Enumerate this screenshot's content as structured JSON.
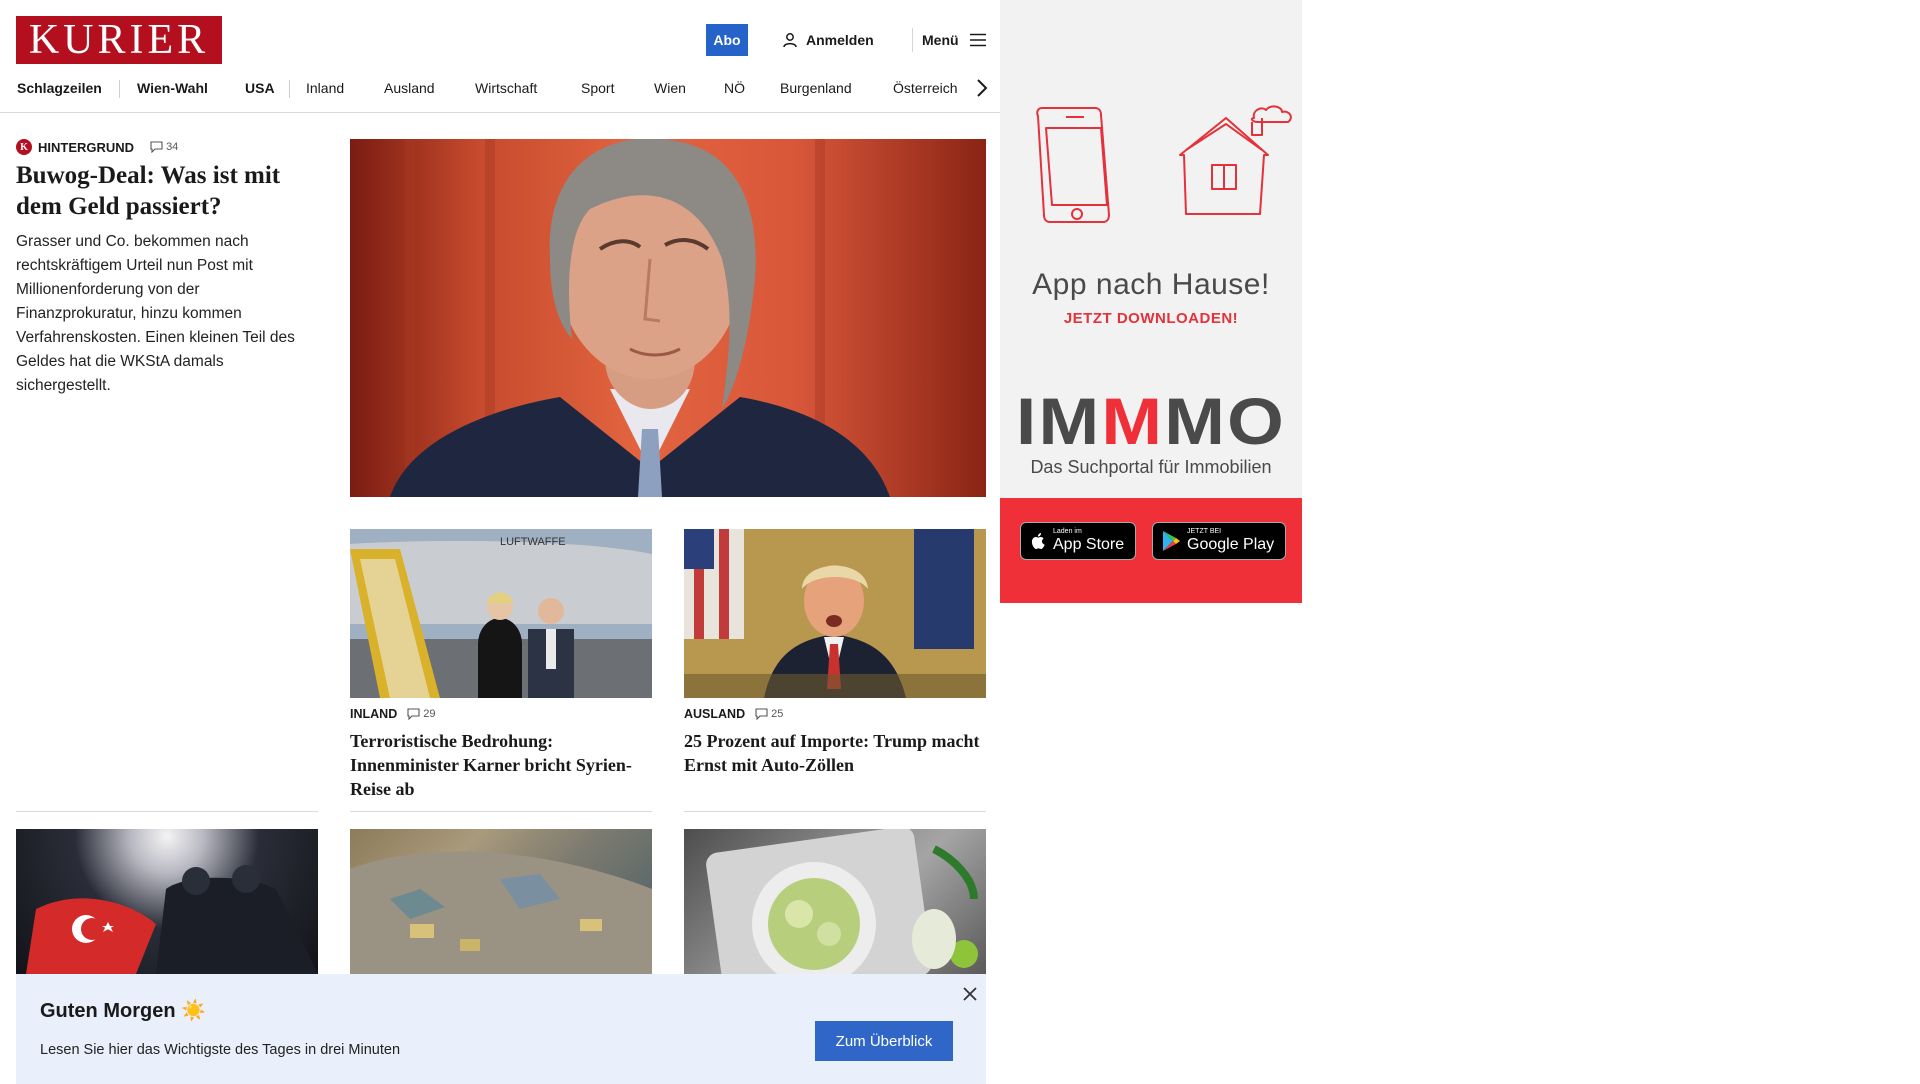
{
  "header": {
    "logo": "KURIER",
    "abo_label": "Abo",
    "login_label": "Anmelden",
    "menu_label": "Menü"
  },
  "nav": {
    "items": [
      "Schlagzeilen",
      "Wien-Wahl",
      "USA",
      "Inland",
      "Ausland",
      "Wirtschaft",
      "Sport",
      "Wien",
      "NÖ",
      "Burgenland",
      "Österreich"
    ]
  },
  "lead": {
    "badge": "K",
    "kicker": "Hintergrund",
    "comments": "34",
    "title": "Buwog-Deal: Was ist mit dem Geld passiert?",
    "teaser": "Grasser und Co. bekommen nach rechtskräftigem Urteil nun Post mit Millionenforderung von der Finanzprokuratur, hinzu kommen Verfahrenskosten. Einen kleinen Teil des Geldes hat die WKStA damals sichergestellt."
  },
  "cards": [
    {
      "kicker": "Inland",
      "comments": "29",
      "title": "Terroristische Bedrohung: Innenminister Karner bricht Syrien-Reise ab",
      "image_text": "LUFTWAFFE"
    },
    {
      "kicker": "Ausland",
      "comments": "25",
      "title": "25 Prozent auf Importe: Trump macht Ernst mit Auto-Zöllen"
    }
  ],
  "ad": {
    "headline": "App nach Hause!",
    "cta": "JETZT DOWNLOADEN!",
    "brand": "IMMMO",
    "tagline": "Das Suchportal für Immobilien",
    "appstore_small": "Laden im",
    "appstore_big": "App Store",
    "googleplay_small": "JETZT BEI",
    "googleplay_big": "Google Play",
    "colors": {
      "red": "#ef3039",
      "gray": "#4a4a4a",
      "background": "#f2f2f2"
    }
  },
  "banner": {
    "title": "Guten Morgen ☀️",
    "subtitle": "Lesen Sie hier das Wichtigste des Tages in drei Minuten",
    "button_label": "Zum Überblick"
  },
  "colors": {
    "brand_red": "#b30f1f",
    "accent_blue": "#2563c9",
    "banner_bg": "#e9effb"
  }
}
